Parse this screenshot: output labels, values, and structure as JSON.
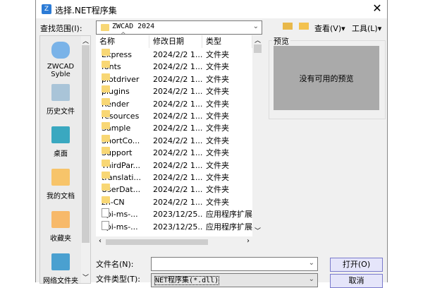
{
  "title": "选择.NET程序集",
  "look_in_label": "查找范围(I):",
  "look_in_value": "ZWCAD 2024",
  "toolbar": {
    "view": "查看(V)",
    "tools": "工具(L)"
  },
  "places": [
    {
      "label": "ZWCAD Syble"
    },
    {
      "label": "历史文件"
    },
    {
      "label": "桌面"
    },
    {
      "label": "我的文档"
    },
    {
      "label": "收藏夹"
    },
    {
      "label": "网络文件夹"
    }
  ],
  "columns": [
    "名称",
    "修改日期",
    "类型"
  ],
  "files": [
    {
      "name": "Express",
      "date": "2024/2/2 1...",
      "type": "文件夹",
      "kind": "folder"
    },
    {
      "name": "fonts",
      "date": "2024/2/2 1...",
      "type": "文件夹",
      "kind": "folder"
    },
    {
      "name": "plotdriver",
      "date": "2024/2/2 1...",
      "type": "文件夹",
      "kind": "folder"
    },
    {
      "name": "plugins",
      "date": "2024/2/2 1...",
      "type": "文件夹",
      "kind": "folder"
    },
    {
      "name": "Render",
      "date": "2024/2/2 1...",
      "type": "文件夹",
      "kind": "folder"
    },
    {
      "name": "resources",
      "date": "2024/2/2 1...",
      "type": "文件夹",
      "kind": "folder"
    },
    {
      "name": "Sample",
      "date": "2024/2/2 1...",
      "type": "文件夹",
      "kind": "folder"
    },
    {
      "name": "ShortCo...",
      "date": "2024/2/2 1...",
      "type": "文件夹",
      "kind": "folder"
    },
    {
      "name": "Support",
      "date": "2024/2/2 1...",
      "type": "文件夹",
      "kind": "folder"
    },
    {
      "name": "ThirdPar...",
      "date": "2024/2/2 1...",
      "type": "文件夹",
      "kind": "folder"
    },
    {
      "name": "translati...",
      "date": "2024/2/2 1...",
      "type": "文件夹",
      "kind": "folder"
    },
    {
      "name": "UserDat...",
      "date": "2024/2/2 1...",
      "type": "文件夹",
      "kind": "folder"
    },
    {
      "name": "zh-CN",
      "date": "2024/2/2 1...",
      "type": "文件夹",
      "kind": "folder"
    },
    {
      "name": "api-ms-...",
      "date": "2023/12/25...",
      "type": "应用程序扩展",
      "kind": "file"
    },
    {
      "name": "api-ms-...",
      "date": "2023/12/25...",
      "type": "应用程序扩展",
      "kind": "file"
    }
  ],
  "preview": {
    "label": "预览",
    "empty_text": "没有可用的预览"
  },
  "filename": {
    "label": "文件名(N):",
    "value": ""
  },
  "filetype": {
    "label": "文件类型(T):",
    "value": "NET程序集(*.dll)"
  },
  "buttons": {
    "open": "打开(O)",
    "cancel": "取消"
  }
}
